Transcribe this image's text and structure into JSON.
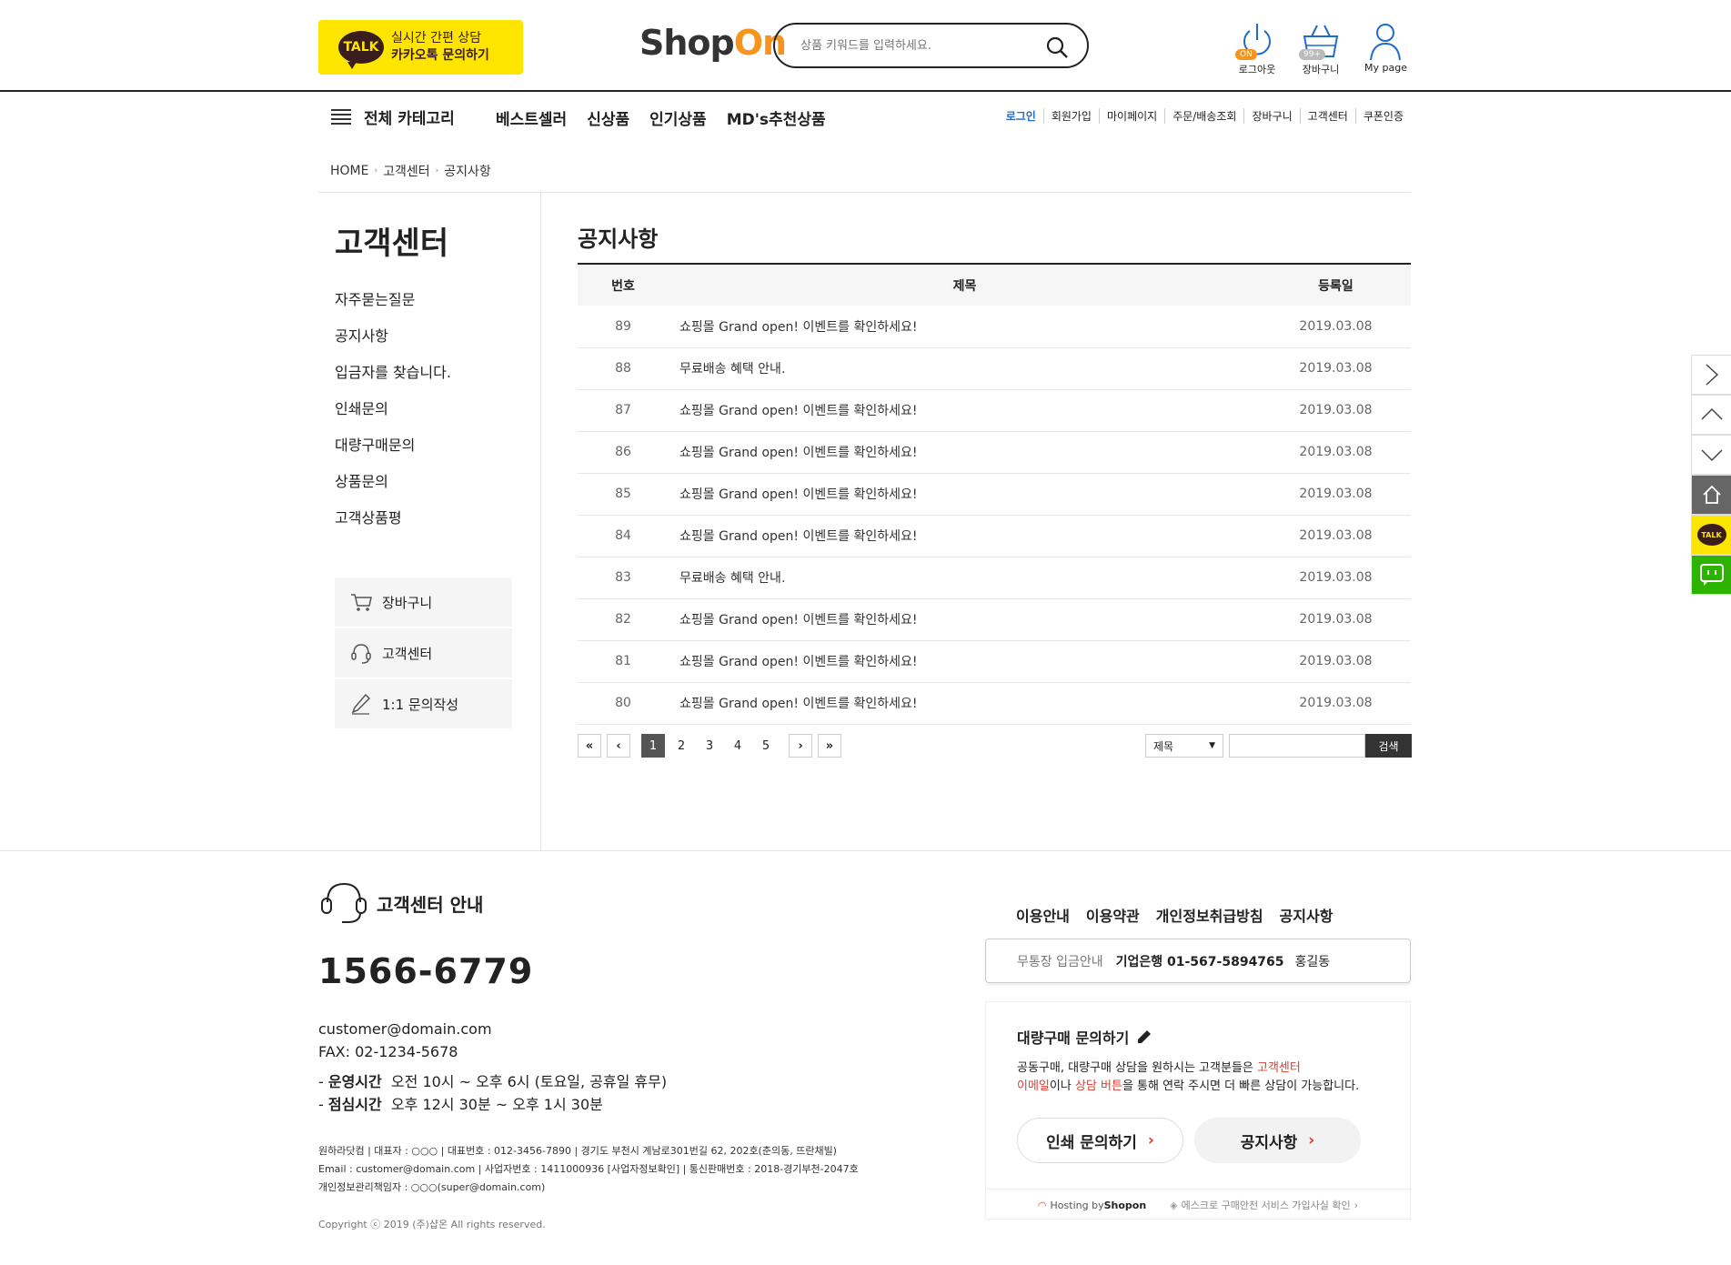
{
  "header": {
    "talk_line1": "실시간 간편 상담",
    "talk_line2": "카카오톡 문의하기",
    "talk_icon_text": "TALK",
    "logo_part1": "Shop",
    "logo_part2": "On",
    "search_placeholder": "상품 키워드를 입력하세요.",
    "logout_label": "로그아웃",
    "logout_badge": "ON",
    "cart_label": "장바구니",
    "cart_badge": "99+",
    "mypage_label": "My page"
  },
  "nav": {
    "all_category": "전체 카테고리",
    "main_menu": [
      "베스트셀러",
      "신상품",
      "인기상품",
      "MD's추천상품"
    ],
    "top_menu": [
      "로그인",
      "회원가입",
      "마이페이지",
      "주문/배송조회",
      "장바구니",
      "고객센터",
      "쿠폰인증"
    ]
  },
  "breadcrumb": [
    "HOME",
    "고객센터",
    "공지사항"
  ],
  "sidebar": {
    "title": "고객센터",
    "menu": [
      "자주묻는질문",
      "공지사항",
      "입금자를 찾습니다.",
      "인쇄문의",
      "대량구매문의",
      "상품문의",
      "고객상품평"
    ],
    "quick_links": [
      "장바구니",
      "고객센터",
      "1:1 문의작성"
    ]
  },
  "board": {
    "title": "공지사항",
    "headers": [
      "번호",
      "제목",
      "등록일"
    ],
    "rows": [
      {
        "num": "89",
        "subject": "쇼핑몰 Grand open! 이벤트를 확인하세요!",
        "date": "2019.03.08"
      },
      {
        "num": "88",
        "subject": "무료배송 혜택 안내.",
        "date": "2019.03.08"
      },
      {
        "num": "87",
        "subject": "쇼핑몰 Grand open! 이벤트를 확인하세요!",
        "date": "2019.03.08"
      },
      {
        "num": "86",
        "subject": "쇼핑몰 Grand open! 이벤트를 확인하세요!",
        "date": "2019.03.08"
      },
      {
        "num": "85",
        "subject": "쇼핑몰 Grand open! 이벤트를 확인하세요!",
        "date": "2019.03.08"
      },
      {
        "num": "84",
        "subject": "쇼핑몰 Grand open! 이벤트를 확인하세요!",
        "date": "2019.03.08"
      },
      {
        "num": "83",
        "subject": "무료배송 혜택 안내.",
        "date": "2019.03.08"
      },
      {
        "num": "82",
        "subject": "쇼핑몰 Grand open! 이벤트를 확인하세요!",
        "date": "2019.03.08"
      },
      {
        "num": "81",
        "subject": "쇼핑몰 Grand open! 이벤트를 확인하세요!",
        "date": "2019.03.08"
      },
      {
        "num": "80",
        "subject": "쇼핑몰 Grand open! 이벤트를 확인하세요!",
        "date": "2019.03.08"
      }
    ],
    "pagination": {
      "first": "«",
      "prev": "‹",
      "pages": [
        "1",
        "2",
        "3",
        "4",
        "5"
      ],
      "current": "1",
      "next": "›",
      "last": "»"
    },
    "search_select": "제목",
    "search_button": "검색"
  },
  "quick_bar": {
    "talk_text": "TALK"
  },
  "footer": {
    "cs_title": "고객센터 안내",
    "phone": "1566-6779",
    "email": "customer@domain.com",
    "fax": "FAX: 02-1234-5678",
    "hours_label": "운영시간",
    "hours": "오전 10시 ~ 오후 6시 (토요일, 공휴일 휴무)",
    "lunch_label": "점심시간",
    "lunch": "오후 12시 30분 ~ 오후 1시 30분",
    "company_line1": "원하라닷컴  |  대표자 : ○○○  |  대표번호 : 012-3456-7890  |  경기도 부천시 계남로301번길 62, 202호(춘의동, 뜨란채빌)",
    "company_line2": "Email : customer@domain.com  |  사업자번호 : 1411000936 [사업자정보확인]  |  통신판매번호 : 2018-경기부천-2047호",
    "company_line3": "개인정보관리책임자 : ○○○(super@domain.com)",
    "copyright": "Copyright ⓒ 2019 (주)샵온 All rights reserved.",
    "links": [
      "이용안내",
      "이용약관",
      "개인정보취급방침",
      "공지사항"
    ],
    "bank_label": "무통장 입금안내",
    "bank_account": "기업은행 01-567-5894765",
    "bank_holder": "홍길동",
    "bulk_title": "대량구매 문의하기",
    "bulk_desc_1": "공동구매, 대량구매 상담을 원하시는 고객분들은 ",
    "bulk_desc_hl1": "고객센터",
    "bulk_desc_hl2": "이메일",
    "bulk_desc_2": "이나 ",
    "bulk_desc_hl3": "상담 버튼",
    "bulk_desc_3": "을 통해 연락 주시면 더 빠른 상담이 가능합니다.",
    "btn_print": "인쇄 문의하기",
    "btn_notice": "공지사항",
    "hosting_prefix": "Hosting by ",
    "hosting_brand": "Shopon",
    "escrow": "에스크로 구매안전 서비스 가입사실 확인"
  },
  "colors": {
    "accent_orange": "#f7941d",
    "kakao_yellow": "#fde500",
    "link_blue": "#1e6ccf",
    "highlight_red": "#e03c2f",
    "naver_green": "#2db400"
  }
}
